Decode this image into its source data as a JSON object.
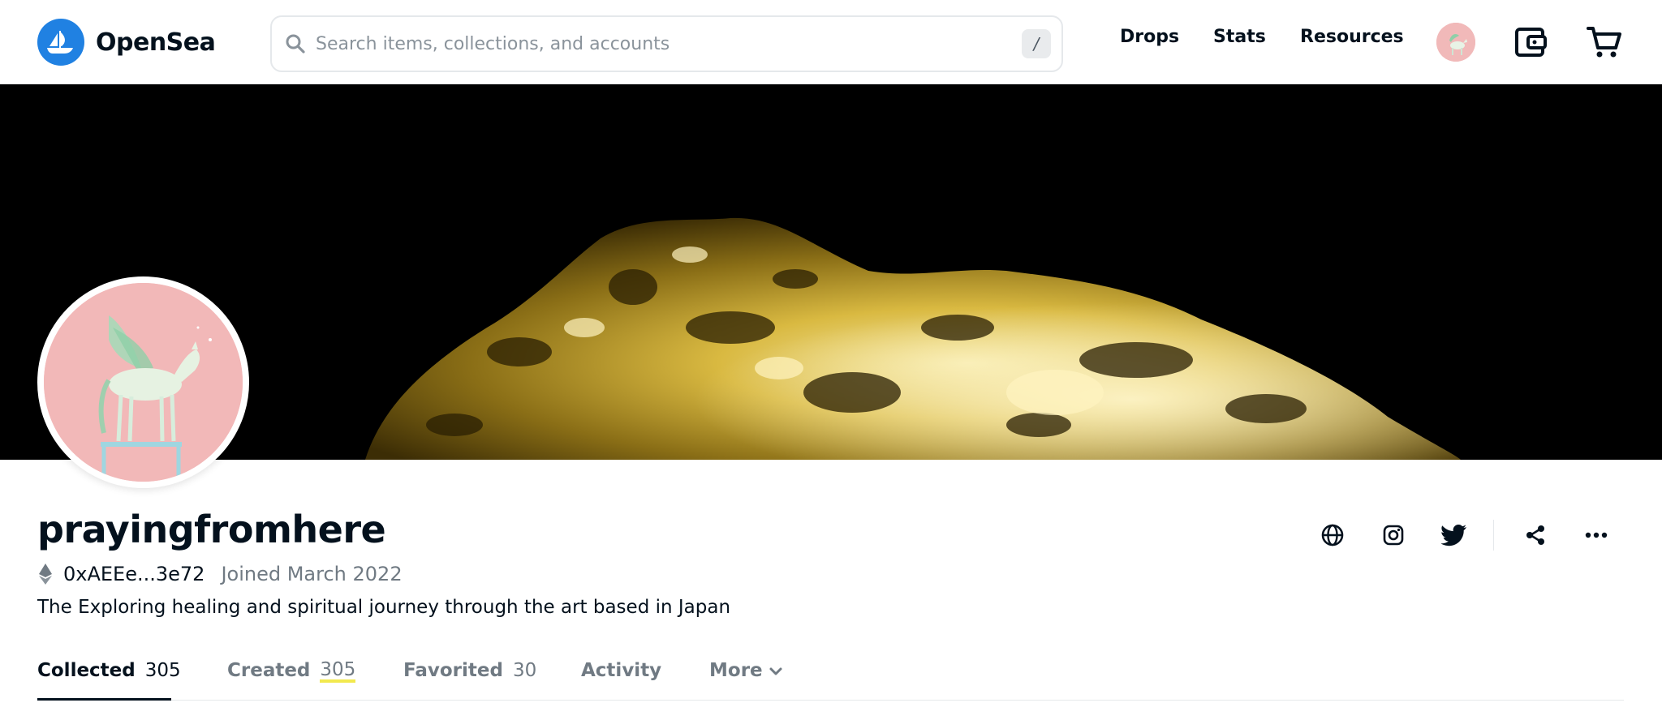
{
  "header": {
    "brand": "OpenSea",
    "search_placeholder": "Search items, collections, and accounts",
    "search_shortcut": "/",
    "nav": [
      "Drops",
      "Stats",
      "Resources"
    ]
  },
  "profile": {
    "username": "prayingfromhere",
    "address": "0xAEEe...3e72",
    "joined": "Joined March 2022",
    "bio": "The Exploring healing and spiritual journey through the art based in Japan"
  },
  "tabs": [
    {
      "label": "Collected",
      "count": "305",
      "active": true
    },
    {
      "label": "Created",
      "count": "305"
    },
    {
      "label": "Favorited",
      "count": "30"
    },
    {
      "label": "Activity",
      "count": ""
    },
    {
      "label": "More",
      "count": ""
    }
  ],
  "colors": {
    "brand_blue": "#2081e2",
    "text_primary": "#04111d",
    "text_secondary": "#707a83",
    "highlight": "#f2e94e"
  },
  "icons": {
    "logo": "opensea-boat-icon",
    "search": "search-icon",
    "wallet": "wallet-icon",
    "cart": "cart-icon",
    "social": [
      "globe-icon",
      "instagram-icon",
      "twitter-icon",
      "share-icon",
      "more-icon"
    ]
  }
}
